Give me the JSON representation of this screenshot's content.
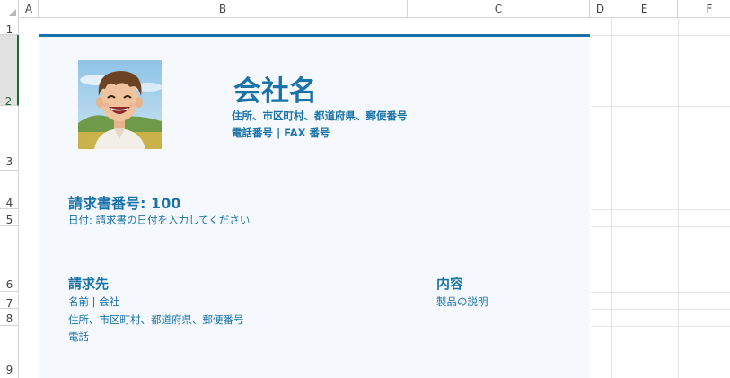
{
  "spreadsheet": {
    "columns": [
      "A",
      "B",
      "C",
      "D",
      "E",
      "F"
    ],
    "rows": [
      "1",
      "2",
      "3",
      "4",
      "5",
      "6",
      "7",
      "8",
      "9"
    ],
    "selected_row": "2"
  },
  "invoice": {
    "accent_color": "#1a73a8",
    "company": {
      "name": "会社名",
      "address": "住所、市区町村、都道府県、郵便番号",
      "contact": "電話番号 | FAX 番号"
    },
    "number_line": "請求書番号: 100",
    "date_line": "日付: 請求書の日付を入力してください",
    "bill_to": {
      "heading": "請求先",
      "name": "名前 | 会社",
      "address": "住所、市区町村、都道府県、郵便番号",
      "phone": "電話"
    },
    "content": {
      "heading": "内容",
      "description": "製品の説明"
    }
  }
}
